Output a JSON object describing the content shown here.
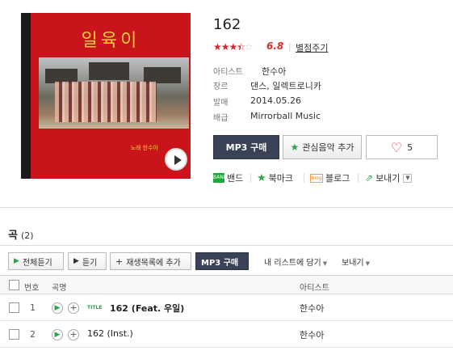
{
  "album": {
    "cover_title": "일육이",
    "cover_subtitle": "노래 한수아",
    "title": "162",
    "rating": "6.8",
    "rating_stars": 3.5,
    "rate_link": "별점주기",
    "meta": [
      {
        "key": "아티스트",
        "value": "한수아"
      },
      {
        "key": "장르",
        "value": "댄스, 일렉트로니카"
      },
      {
        "key": "발매",
        "value": "2014.05.26"
      },
      {
        "key": "배급",
        "value": "Mirrorball Music"
      }
    ]
  },
  "actions": {
    "mp3_label": "MP3 구매",
    "favorite_label": "관심음악 추가",
    "like_count": "5"
  },
  "share": {
    "band": "밴드",
    "bookmark": "북마크",
    "blog": "블로그",
    "send": "보내기",
    "band_icon_text": "BAND",
    "blog_icon_text": "blog"
  },
  "songs": {
    "header": "곡",
    "count": "(2)",
    "toolbar": {
      "play_all": "전체듣기",
      "listen": "듣기",
      "add_playlist": "재생목록에 추가",
      "mp3": "MP3 구매",
      "add_my_list": "내 리스트에 담기",
      "send": "보내기"
    },
    "columns": {
      "num": "번호",
      "title": "곡명",
      "artist": "아티스트"
    },
    "title_badge": "TITLE",
    "rows": [
      {
        "num": "1",
        "title": "162 (Feat. 우일)",
        "artist": "한수아",
        "is_title": true
      },
      {
        "num": "2",
        "title": "162 (Inst.)",
        "artist": "한수아",
        "is_title": false
      }
    ]
  },
  "colors": {
    "accent_red": "#e22c2c",
    "accent_green": "#2aa54a",
    "dark_button": "#3a4257",
    "cover_red": "#c8141a"
  }
}
